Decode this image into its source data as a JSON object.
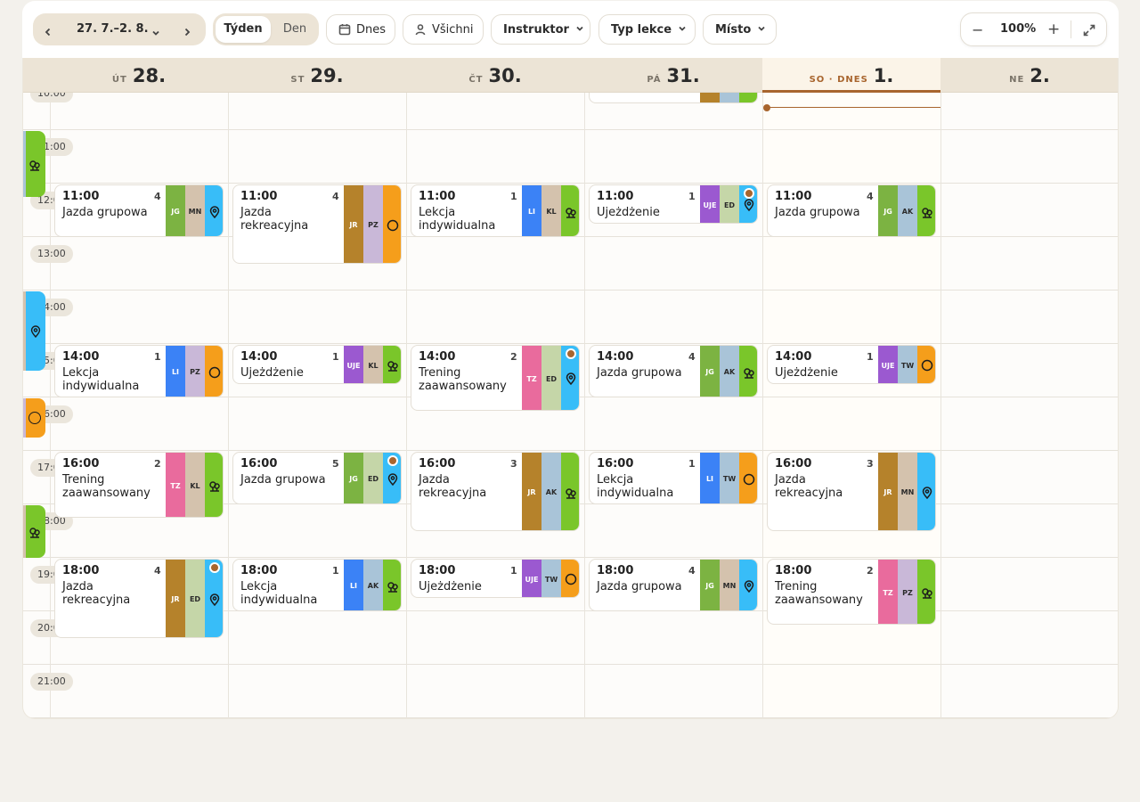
{
  "toolbar": {
    "date_range": "27. 7.–2. 8.",
    "view_week": "Týden",
    "view_day": "Den",
    "today": "Dnes",
    "everyone": "Všichni",
    "instructor": "Instruktor",
    "lesson_type": "Typ lekce",
    "place": "Místo",
    "zoom": "100%"
  },
  "days": [
    {
      "name": "ÚT",
      "date": "28."
    },
    {
      "name": "ST",
      "date": "29."
    },
    {
      "name": "ČT",
      "date": "30."
    },
    {
      "name": "PÁ",
      "date": "31."
    },
    {
      "name": "SO · DNES",
      "date": "1."
    },
    {
      "name": "NE",
      "date": "2."
    }
  ],
  "time_labels": [
    "10:00",
    "11:00",
    "12:00",
    "13:00",
    "14:00",
    "15:00",
    "16:00",
    "17:00",
    "18:00",
    "19:00",
    "20:00",
    "21:00"
  ],
  "colors": {
    "accent": "#a8652e",
    "loc_green": "#7ac62a",
    "loc_blue": "#38bdf8",
    "loc_orange": "#f59e1b"
  },
  "events": [
    {
      "day": 0,
      "time": "11:00",
      "count": "4",
      "title": "Jazda grupowa",
      "instructors": [
        "JG",
        "MN"
      ],
      "location": "pin",
      "dot": false
    },
    {
      "day": 0,
      "time": "14:00",
      "count": "1",
      "title": "Lekcja indywidualna",
      "instructors": [
        "LI",
        "PZ"
      ],
      "location": "ring",
      "dot": false
    },
    {
      "day": 0,
      "time": "16:00",
      "count": "2",
      "title": "Trening zaawansowany",
      "instructors": [
        "TZ",
        "KL"
      ],
      "location": "tree",
      "dot": false
    },
    {
      "day": 0,
      "time": "18:00",
      "count": "4",
      "title": "Jazda rekreacyjna",
      "instructors": [
        "JR",
        "ED"
      ],
      "location": "pin",
      "dot": true
    },
    {
      "day": 1,
      "time": "11:00",
      "count": "4",
      "title": "Jazda rekreacyjna",
      "instructors": [
        "JR",
        "PZ"
      ],
      "location": "ring",
      "dot": false
    },
    {
      "day": 1,
      "time": "14:00",
      "count": "1",
      "title": "Ujeżdżenie",
      "instructors": [
        "UJE",
        "KL"
      ],
      "location": "tree",
      "dot": false
    },
    {
      "day": 1,
      "time": "16:00",
      "count": "5",
      "title": "Jazda grupowa",
      "instructors": [
        "JG",
        "ED"
      ],
      "location": "pin",
      "dot": true
    },
    {
      "day": 1,
      "time": "18:00",
      "count": "1",
      "title": "Lekcja indywidualna",
      "instructors": [
        "LI",
        "AK"
      ],
      "location": "tree",
      "dot": false
    },
    {
      "day": 2,
      "time": "11:00",
      "count": "1",
      "title": "Lekcja indywidualna",
      "instructors": [
        "LI",
        "KL"
      ],
      "location": "tree",
      "dot": false
    },
    {
      "day": 2,
      "time": "14:00",
      "count": "2",
      "title": "Trening zaawansowany",
      "instructors": [
        "TZ",
        "ED"
      ],
      "location": "pin",
      "dot": true
    },
    {
      "day": 2,
      "time": "16:00",
      "count": "3",
      "title": "Jazda rekreacyjna",
      "instructors": [
        "JR",
        "AK"
      ],
      "location": "tree",
      "dot": false
    },
    {
      "day": 2,
      "time": "18:00",
      "count": "1",
      "title": "Ujeżdżenie",
      "instructors": [
        "UJE",
        "TW"
      ],
      "location": "ring",
      "dot": false
    },
    {
      "day": 3,
      "time": "11:00",
      "count": "1",
      "title": "Ujeżdżenie",
      "instructors": [
        "UJE",
        "ED"
      ],
      "location": "pin",
      "dot": true
    },
    {
      "day": 3,
      "time": "14:00",
      "count": "4",
      "title": "Jazda grupowa",
      "instructors": [
        "JG",
        "AK"
      ],
      "location": "tree",
      "dot": false
    },
    {
      "day": 3,
      "time": "16:00",
      "count": "1",
      "title": "Lekcja indywidualna",
      "instructors": [
        "LI",
        "TW"
      ],
      "location": "ring",
      "dot": false
    },
    {
      "day": 3,
      "time": "18:00",
      "count": "4",
      "title": "Jazda grupowa",
      "instructors": [
        "JG",
        "MN"
      ],
      "location": "pin",
      "dot": false
    },
    {
      "day": 4,
      "time": "11:00",
      "count": "4",
      "title": "Jazda grupowa",
      "instructors": [
        "JG",
        "AK"
      ],
      "location": "tree",
      "dot": false
    },
    {
      "day": 4,
      "time": "14:00",
      "count": "1",
      "title": "Ujeżdżenie",
      "instructors": [
        "UJE",
        "TW"
      ],
      "location": "ring",
      "dot": false
    },
    {
      "day": 4,
      "time": "16:00",
      "count": "3",
      "title": "Jazda rekreacyjna",
      "instructors": [
        "JR",
        "MN"
      ],
      "location": "pin",
      "dot": false
    },
    {
      "day": 4,
      "time": "18:00",
      "count": "2",
      "title": "Trening zaawansowany",
      "instructors": [
        "TZ",
        "PZ"
      ],
      "location": "tree",
      "dot": false
    }
  ],
  "instructor_colors": {
    "JG": {
      "bg": "#7cb342",
      "fg": "#ffffff"
    },
    "MN": {
      "bg": "#d4c2ad",
      "fg": "#2b2b2b"
    },
    "LI": {
      "bg": "#3b82f6",
      "fg": "#ffffff"
    },
    "PZ": {
      "bg": "#c9b8d8",
      "fg": "#2b2b2b"
    },
    "TZ": {
      "bg": "#e96b9d",
      "fg": "#ffffff"
    },
    "KL": {
      "bg": "#d4c2ad",
      "fg": "#2b2b2b"
    },
    "JR": {
      "bg": "#b5822b",
      "fg": "#ffffff"
    },
    "ED": {
      "bg": "#c5d6a8",
      "fg": "#2b2b2b"
    },
    "UJE": {
      "bg": "#9b59d0",
      "fg": "#ffffff"
    },
    "AK": {
      "bg": "#a9c4d8",
      "fg": "#2b2b2b"
    },
    "TW": {
      "bg": "#a9c4d8",
      "fg": "#2b2b2b"
    }
  }
}
